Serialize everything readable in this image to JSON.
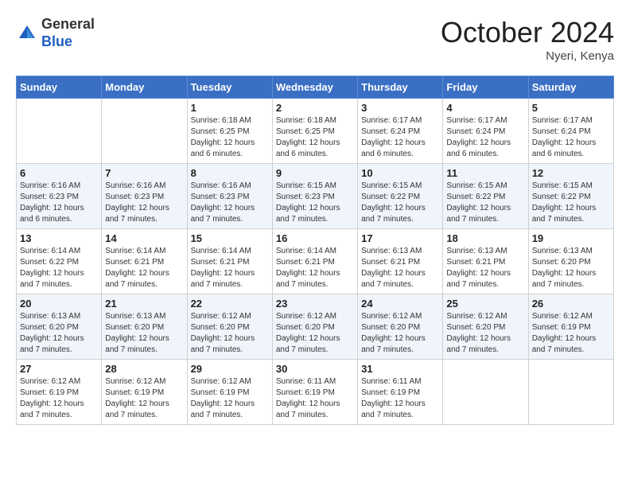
{
  "logo": {
    "general": "General",
    "blue": "Blue"
  },
  "title": "October 2024",
  "location": "Nyeri, Kenya",
  "days_header": [
    "Sunday",
    "Monday",
    "Tuesday",
    "Wednesday",
    "Thursday",
    "Friday",
    "Saturday"
  ],
  "weeks": [
    [
      {
        "day": "",
        "info": ""
      },
      {
        "day": "",
        "info": ""
      },
      {
        "day": "1",
        "info": "Sunrise: 6:18 AM\nSunset: 6:25 PM\nDaylight: 12 hours\nand 6 minutes."
      },
      {
        "day": "2",
        "info": "Sunrise: 6:18 AM\nSunset: 6:25 PM\nDaylight: 12 hours\nand 6 minutes."
      },
      {
        "day": "3",
        "info": "Sunrise: 6:17 AM\nSunset: 6:24 PM\nDaylight: 12 hours\nand 6 minutes."
      },
      {
        "day": "4",
        "info": "Sunrise: 6:17 AM\nSunset: 6:24 PM\nDaylight: 12 hours\nand 6 minutes."
      },
      {
        "day": "5",
        "info": "Sunrise: 6:17 AM\nSunset: 6:24 PM\nDaylight: 12 hours\nand 6 minutes."
      }
    ],
    [
      {
        "day": "6",
        "info": "Sunrise: 6:16 AM\nSunset: 6:23 PM\nDaylight: 12 hours\nand 6 minutes."
      },
      {
        "day": "7",
        "info": "Sunrise: 6:16 AM\nSunset: 6:23 PM\nDaylight: 12 hours\nand 7 minutes."
      },
      {
        "day": "8",
        "info": "Sunrise: 6:16 AM\nSunset: 6:23 PM\nDaylight: 12 hours\nand 7 minutes."
      },
      {
        "day": "9",
        "info": "Sunrise: 6:15 AM\nSunset: 6:23 PM\nDaylight: 12 hours\nand 7 minutes."
      },
      {
        "day": "10",
        "info": "Sunrise: 6:15 AM\nSunset: 6:22 PM\nDaylight: 12 hours\nand 7 minutes."
      },
      {
        "day": "11",
        "info": "Sunrise: 6:15 AM\nSunset: 6:22 PM\nDaylight: 12 hours\nand 7 minutes."
      },
      {
        "day": "12",
        "info": "Sunrise: 6:15 AM\nSunset: 6:22 PM\nDaylight: 12 hours\nand 7 minutes."
      }
    ],
    [
      {
        "day": "13",
        "info": "Sunrise: 6:14 AM\nSunset: 6:22 PM\nDaylight: 12 hours\nand 7 minutes."
      },
      {
        "day": "14",
        "info": "Sunrise: 6:14 AM\nSunset: 6:21 PM\nDaylight: 12 hours\nand 7 minutes."
      },
      {
        "day": "15",
        "info": "Sunrise: 6:14 AM\nSunset: 6:21 PM\nDaylight: 12 hours\nand 7 minutes."
      },
      {
        "day": "16",
        "info": "Sunrise: 6:14 AM\nSunset: 6:21 PM\nDaylight: 12 hours\nand 7 minutes."
      },
      {
        "day": "17",
        "info": "Sunrise: 6:13 AM\nSunset: 6:21 PM\nDaylight: 12 hours\nand 7 minutes."
      },
      {
        "day": "18",
        "info": "Sunrise: 6:13 AM\nSunset: 6:21 PM\nDaylight: 12 hours\nand 7 minutes."
      },
      {
        "day": "19",
        "info": "Sunrise: 6:13 AM\nSunset: 6:20 PM\nDaylight: 12 hours\nand 7 minutes."
      }
    ],
    [
      {
        "day": "20",
        "info": "Sunrise: 6:13 AM\nSunset: 6:20 PM\nDaylight: 12 hours\nand 7 minutes."
      },
      {
        "day": "21",
        "info": "Sunrise: 6:13 AM\nSunset: 6:20 PM\nDaylight: 12 hours\nand 7 minutes."
      },
      {
        "day": "22",
        "info": "Sunrise: 6:12 AM\nSunset: 6:20 PM\nDaylight: 12 hours\nand 7 minutes."
      },
      {
        "day": "23",
        "info": "Sunrise: 6:12 AM\nSunset: 6:20 PM\nDaylight: 12 hours\nand 7 minutes."
      },
      {
        "day": "24",
        "info": "Sunrise: 6:12 AM\nSunset: 6:20 PM\nDaylight: 12 hours\nand 7 minutes."
      },
      {
        "day": "25",
        "info": "Sunrise: 6:12 AM\nSunset: 6:20 PM\nDaylight: 12 hours\nand 7 minutes."
      },
      {
        "day": "26",
        "info": "Sunrise: 6:12 AM\nSunset: 6:19 PM\nDaylight: 12 hours\nand 7 minutes."
      }
    ],
    [
      {
        "day": "27",
        "info": "Sunrise: 6:12 AM\nSunset: 6:19 PM\nDaylight: 12 hours\nand 7 minutes."
      },
      {
        "day": "28",
        "info": "Sunrise: 6:12 AM\nSunset: 6:19 PM\nDaylight: 12 hours\nand 7 minutes."
      },
      {
        "day": "29",
        "info": "Sunrise: 6:12 AM\nSunset: 6:19 PM\nDaylight: 12 hours\nand 7 minutes."
      },
      {
        "day": "30",
        "info": "Sunrise: 6:11 AM\nSunset: 6:19 PM\nDaylight: 12 hours\nand 7 minutes."
      },
      {
        "day": "31",
        "info": "Sunrise: 6:11 AM\nSunset: 6:19 PM\nDaylight: 12 hours\nand 7 minutes."
      },
      {
        "day": "",
        "info": ""
      },
      {
        "day": "",
        "info": ""
      }
    ]
  ]
}
